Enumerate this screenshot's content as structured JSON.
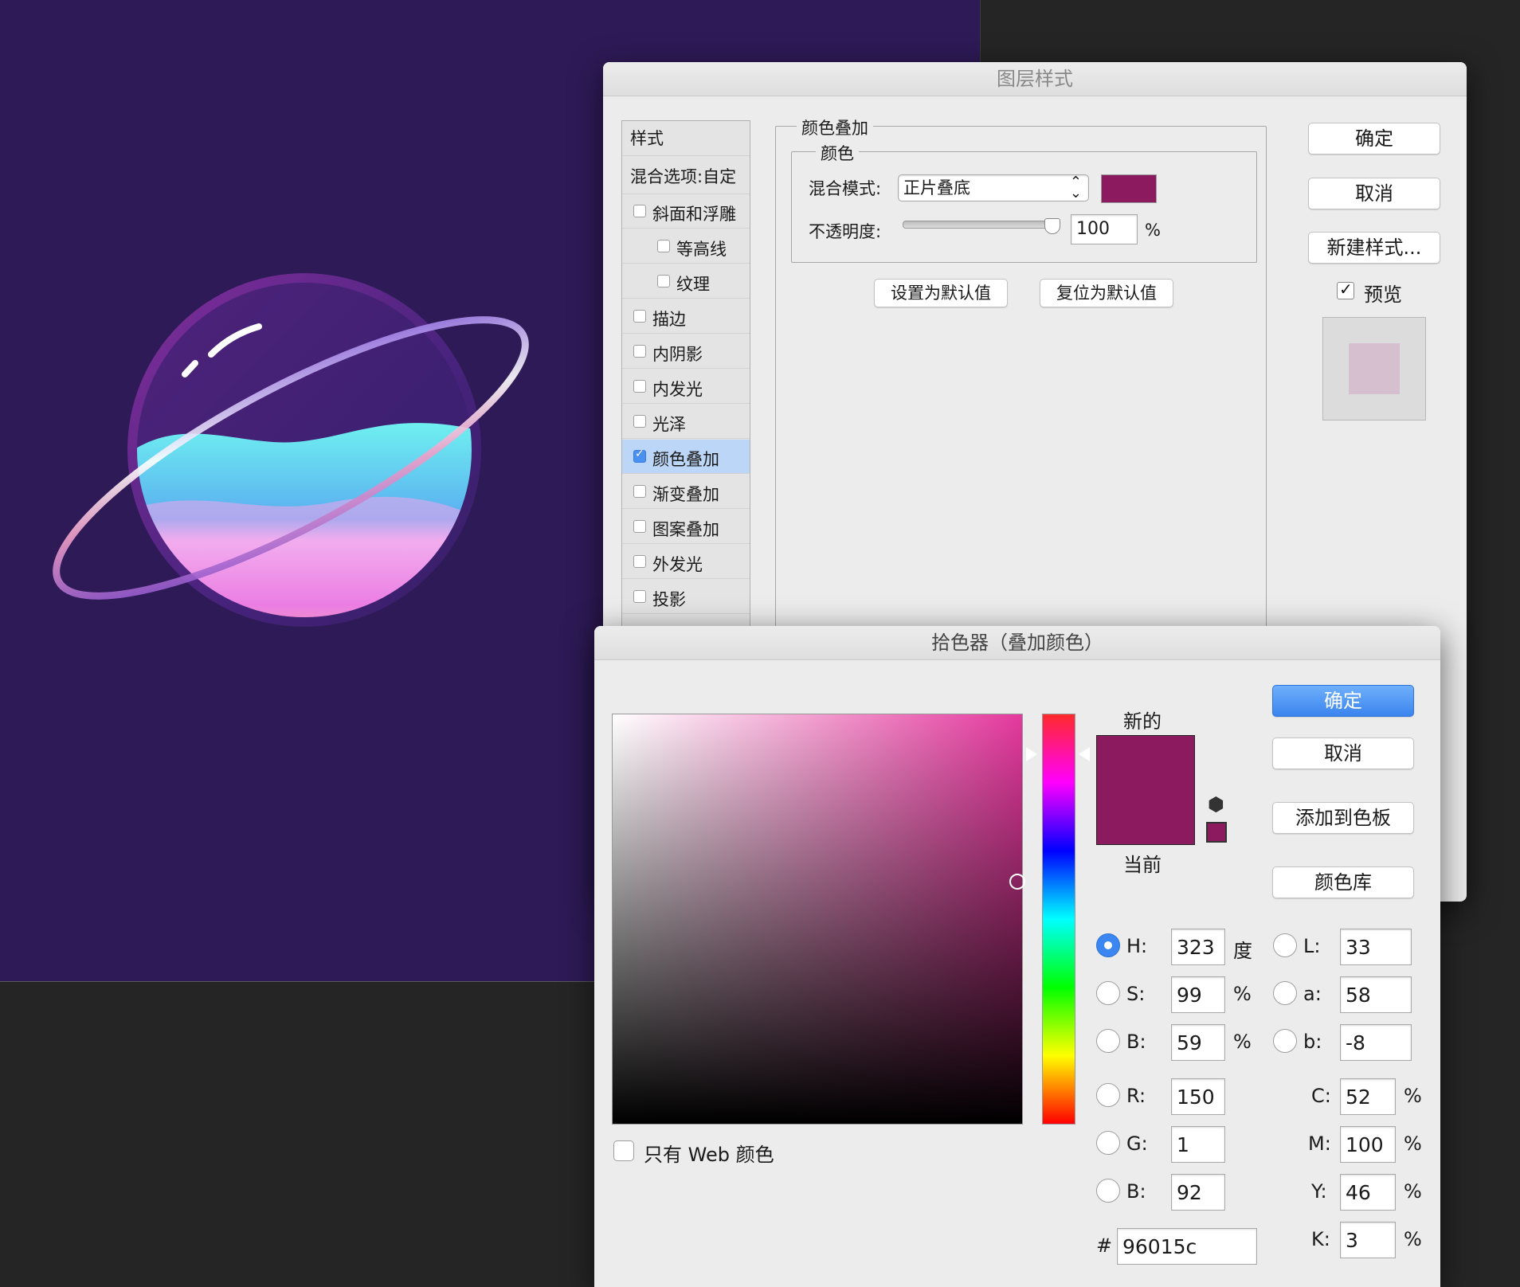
{
  "layer_style": {
    "title": "图层样式",
    "styles_header": "样式",
    "blend_options": "混合选项:自定",
    "effects": [
      {
        "label": "斜面和浮雕",
        "checked": false,
        "indent": 0
      },
      {
        "label": "等高线",
        "checked": false,
        "indent": 1
      },
      {
        "label": "纹理",
        "checked": false,
        "indent": 1
      },
      {
        "label": "描边",
        "checked": false,
        "indent": 0
      },
      {
        "label": "内阴影",
        "checked": false,
        "indent": 0
      },
      {
        "label": "内发光",
        "checked": false,
        "indent": 0
      },
      {
        "label": "光泽",
        "checked": false,
        "indent": 0
      },
      {
        "label": "颜色叠加",
        "checked": true,
        "indent": 0,
        "selected": true
      },
      {
        "label": "渐变叠加",
        "checked": false,
        "indent": 0
      },
      {
        "label": "图案叠加",
        "checked": false,
        "indent": 0
      },
      {
        "label": "外发光",
        "checked": false,
        "indent": 0
      },
      {
        "label": "投影",
        "checked": false,
        "indent": 0
      }
    ],
    "panel_title": "颜色叠加",
    "color_group": "颜色",
    "blend_mode_label": "混合模式:",
    "blend_mode_value": "正片叠底",
    "overlay_color": "#8c1a5e",
    "opacity_label": "不透明度:",
    "opacity_value": "100",
    "opacity_unit": "%",
    "set_default": "设置为默认值",
    "reset_default": "复位为默认值",
    "ok": "确定",
    "cancel": "取消",
    "new_style": "新建样式...",
    "preview_label": "预览",
    "preview_checked": true
  },
  "color_picker": {
    "title": "拾色器（叠加颜色）",
    "ok": "确定",
    "cancel": "取消",
    "add_to_swatches": "添加到色板",
    "color_libraries": "颜色库",
    "new_label": "新的",
    "current_label": "当前",
    "new_color": "#8c1a5e",
    "web_only_label": "只有 Web 颜色",
    "hsb": {
      "H": "323",
      "S": "99",
      "B": "59"
    },
    "hsb_units": {
      "H": "度",
      "S": "%",
      "B": "%"
    },
    "rgb": {
      "R": "150",
      "G": "1",
      "B": "92"
    },
    "lab": {
      "L": "33",
      "a": "58",
      "b": "-8"
    },
    "cmyk": {
      "C": "52",
      "M": "100",
      "Y": "46",
      "K": "3"
    },
    "cmyk_unit": "%",
    "hex_prefix": "#",
    "hex": "96015c",
    "labels": {
      "H": "H:",
      "S": "S:",
      "Bv": "B:",
      "R": "R:",
      "G": "G:",
      "Bb": "B:",
      "L": "L:",
      "a": "a:",
      "b": "b:",
      "C": "C:",
      "M": "M:",
      "Y": "Y:",
      "K": "K:"
    },
    "hue_marker_fraction": 0.1
  }
}
